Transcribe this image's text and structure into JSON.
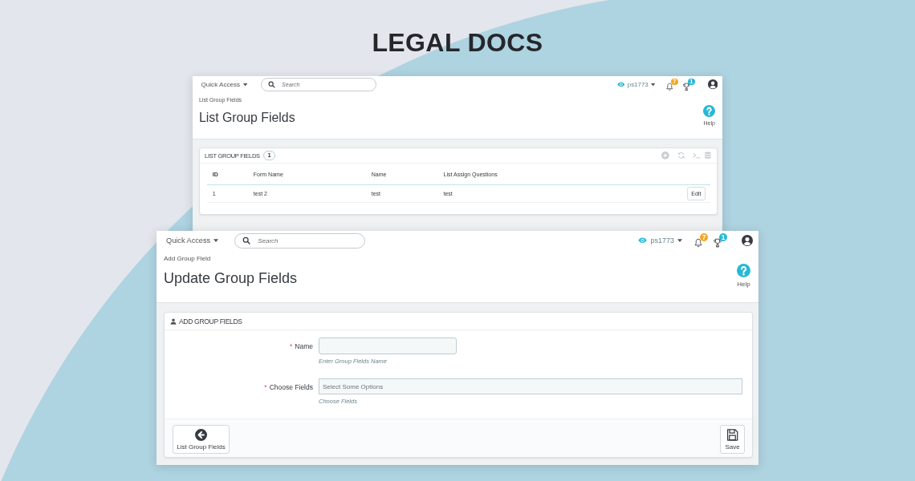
{
  "title": "LEGAL DOCS",
  "windows": [
    {
      "header": {
        "quick_access": "Quick Access",
        "search": {
          "placeholder": "Search"
        },
        "shop": "ps1773",
        "notifications": [
          {
            "kind": "bell",
            "count": "7",
            "color": "#f5a623"
          },
          {
            "kind": "trophy",
            "count": "1",
            "color": "#25b9d7"
          }
        ]
      },
      "breadcrumb": "List Group Fields",
      "page_title": "List Group Fields",
      "help": "Help",
      "panel": {
        "kind": "table",
        "heading": "LIST GROUP FIELDS",
        "count": "1",
        "columns": [
          "ID",
          "Form Name",
          "Name",
          "List Assign Questions"
        ],
        "rows": [
          {
            "cells": [
              "1",
              "test 2",
              "test",
              "test"
            ],
            "action": "Edit"
          }
        ]
      }
    },
    {
      "header": {
        "quick_access": "Quick Access",
        "search": {
          "placeholder": "Search"
        },
        "shop": "ps1773",
        "notifications": [
          {
            "kind": "bell",
            "count": "7",
            "color": "#f5a623"
          },
          {
            "kind": "trophy",
            "count": "1",
            "color": "#25b9d7"
          }
        ]
      },
      "breadcrumb": "Add Group Field",
      "page_title": "Update Group Fields",
      "help": "Help",
      "panel": {
        "kind": "form",
        "heading": "ADD GROUP FIELDS",
        "fields": [
          {
            "kind": "text",
            "required_mark": "*",
            "label": "Name",
            "hint": "Enter Group Fields Name"
          },
          {
            "kind": "select",
            "required_mark": "*",
            "label": "Choose Fields",
            "placeholder": "Select Some Options",
            "hint": "Choose Fields"
          }
        ],
        "buttons": [
          {
            "kind": "back",
            "label": "List Group Fields"
          },
          {
            "kind": "save",
            "label": "Save"
          }
        ]
      }
    }
  ]
}
